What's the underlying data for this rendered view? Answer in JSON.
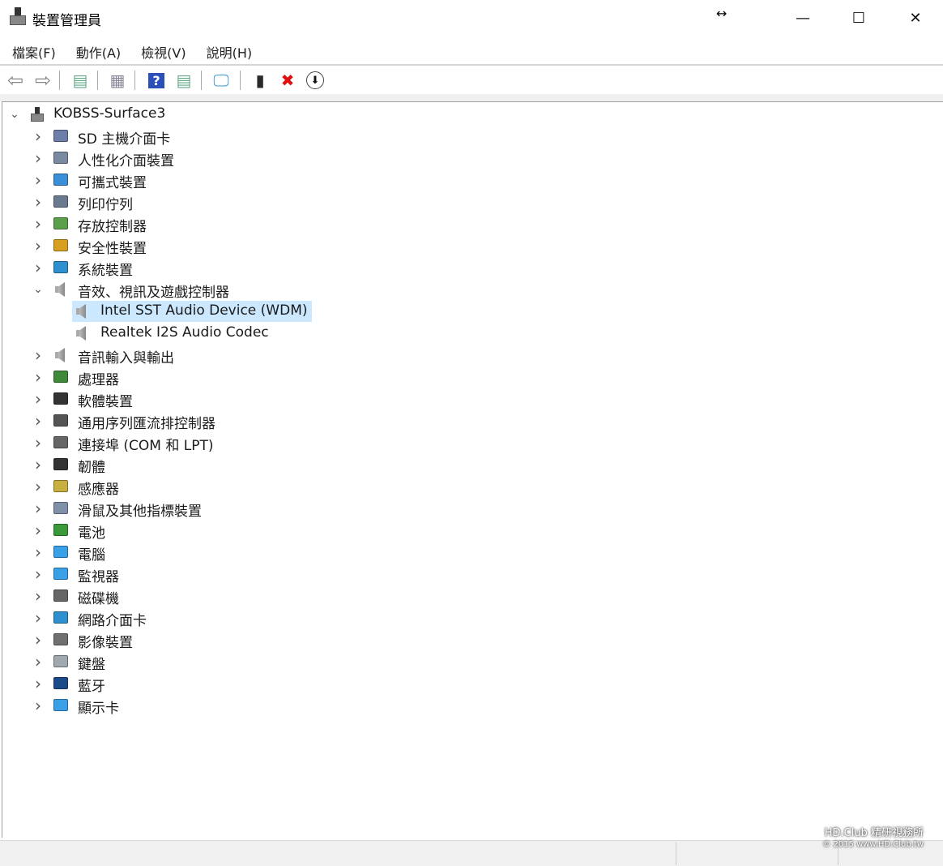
{
  "window": {
    "title": "裝置管理員",
    "resize_glyph": "↔",
    "minimize": "—",
    "maximize": "☐",
    "close": "✕"
  },
  "menu": [
    "檔案(F)",
    "動作(A)",
    "檢視(V)",
    "說明(H)"
  ],
  "toolbar": [
    {
      "name": "back-button",
      "icon": "arrow-left-icon",
      "glyph": "⇦"
    },
    {
      "name": "forward-button",
      "icon": "arrow-right-icon",
      "glyph": "⇨"
    },
    {
      "name": "show-hide-console-tree-button",
      "icon": "console-tree-icon",
      "glyph": "▤"
    },
    {
      "name": "properties-button",
      "icon": "properties-icon",
      "glyph": "▦"
    },
    {
      "name": "help-button",
      "icon": "help-icon",
      "glyph": "?"
    },
    {
      "name": "show-action-pane-button",
      "icon": "action-pane-icon",
      "glyph": "▤"
    },
    {
      "name": "scan-hardware-button",
      "icon": "scan-monitor-icon",
      "glyph": "🖵"
    },
    {
      "name": "update-driver-button",
      "icon": "update-driver-icon",
      "glyph": "▮"
    },
    {
      "name": "uninstall-device-button",
      "icon": "red-x-icon",
      "glyph": "✖"
    },
    {
      "name": "disable-device-button",
      "icon": "down-arrow-circle-icon",
      "glyph": "⬇"
    }
  ],
  "colors": {
    "selection": "#cce8ff",
    "uninstall": "#e01010",
    "help": "#2b50b8"
  },
  "tree": {
    "root": "KOBSS-Surface3",
    "items": [
      {
        "label": "SD 主機介面卡",
        "icon": "sd-card-icon",
        "color": "#6d7fa8",
        "expanded": false
      },
      {
        "label": "人性化介面裝置",
        "icon": "hid-icon",
        "color": "#7a8aa0",
        "expanded": false
      },
      {
        "label": "可攜式裝置",
        "icon": "portable-device-icon",
        "color": "#3a8fd8",
        "expanded": false
      },
      {
        "label": "列印佇列",
        "icon": "printer-icon",
        "color": "#6a7a90",
        "expanded": false
      },
      {
        "label": "存放控制器",
        "icon": "storage-controller-icon",
        "color": "#5aa04a",
        "expanded": false
      },
      {
        "label": "安全性裝置",
        "icon": "security-device-icon",
        "color": "#d8a020",
        "expanded": false
      },
      {
        "label": "系統裝置",
        "icon": "system-device-icon",
        "color": "#2f90d0",
        "expanded": false
      },
      {
        "label": "音效、視訊及遊戲控制器",
        "icon": "speaker-icon",
        "color": "#9a9a9a",
        "expanded": true,
        "children": [
          {
            "label": "Intel SST Audio Device (WDM)",
            "icon": "speaker-icon",
            "selected": true
          },
          {
            "label": "Realtek I2S Audio Codec",
            "icon": "speaker-icon",
            "selected": false
          }
        ]
      },
      {
        "label": "音訊輸入與輸出",
        "icon": "speaker-icon",
        "color": "#9a9a9a",
        "expanded": false
      },
      {
        "label": "處理器",
        "icon": "processor-icon",
        "color": "#3f8a3a",
        "expanded": false
      },
      {
        "label": "軟體裝置",
        "icon": "software-device-icon",
        "color": "#333333",
        "expanded": false
      },
      {
        "label": "通用序列匯流排控制器",
        "icon": "usb-icon",
        "color": "#555555",
        "expanded": false
      },
      {
        "label": "連接埠 (COM 和 LPT)",
        "icon": "port-icon",
        "color": "#666666",
        "expanded": false
      },
      {
        "label": "韌體",
        "icon": "firmware-chip-icon",
        "color": "#333333",
        "expanded": false
      },
      {
        "label": "感應器",
        "icon": "sensor-icon",
        "color": "#c8b040",
        "expanded": false
      },
      {
        "label": "滑鼠及其他指標裝置",
        "icon": "mouse-icon",
        "color": "#8090a8",
        "expanded": false
      },
      {
        "label": "電池",
        "icon": "battery-icon",
        "color": "#3a9a3a",
        "expanded": false
      },
      {
        "label": "電腦",
        "icon": "computer-icon",
        "color": "#3aa0e8",
        "expanded": false
      },
      {
        "label": "監視器",
        "icon": "monitor-icon",
        "color": "#3aa0e8",
        "expanded": false
      },
      {
        "label": "磁碟機",
        "icon": "disk-drive-icon",
        "color": "#666666",
        "expanded": false
      },
      {
        "label": "網路介面卡",
        "icon": "network-adapter-icon",
        "color": "#2f90d0",
        "expanded": false
      },
      {
        "label": "影像裝置",
        "icon": "camera-icon",
        "color": "#707070",
        "expanded": false
      },
      {
        "label": "鍵盤",
        "icon": "keyboard-icon",
        "color": "#a0a8b0",
        "expanded": false
      },
      {
        "label": "藍牙",
        "icon": "bluetooth-icon",
        "color": "#1a4a8a",
        "expanded": false
      },
      {
        "label": "顯示卡",
        "icon": "display-adapter-icon",
        "color": "#3aa0e8",
        "expanded": false
      }
    ]
  },
  "watermark": {
    "line1": "HD.Club 精研視務所",
    "line2": "© 2015  www.HD.Club.tw"
  }
}
